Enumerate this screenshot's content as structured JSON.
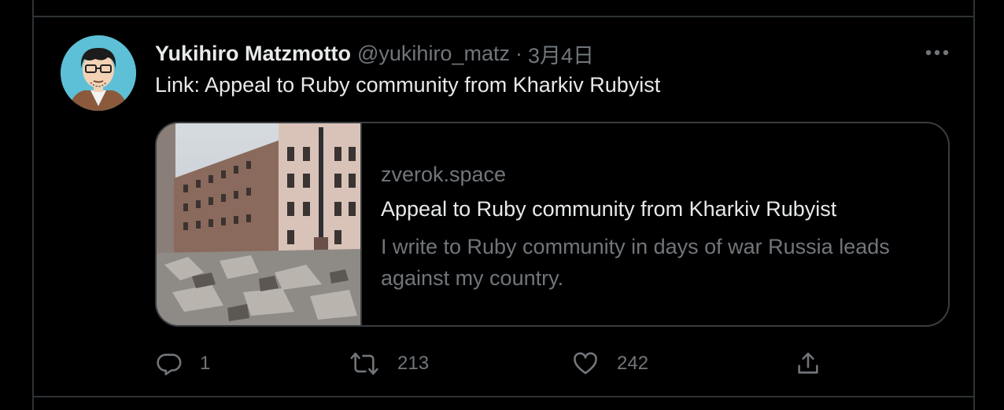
{
  "tweet": {
    "author_name": "Yukihiro Matzmotto",
    "author_handle": "@yukihiro_matz",
    "separator": "·",
    "timestamp": "3月4日",
    "text": "Link: Appeal to Ruby community from Kharkiv Rubyist"
  },
  "card": {
    "domain": "zverok.space",
    "title": "Appeal to Ruby community from Kharkiv Rubyist",
    "description": "I write to Ruby community in days of war Russia leads against my country."
  },
  "actions": {
    "reply_count": "1",
    "retweet_count": "213",
    "like_count": "242"
  },
  "icons": {
    "more": "more-icon",
    "reply": "reply-icon",
    "retweet": "retweet-icon",
    "like": "heart-icon",
    "share": "share-icon"
  },
  "colors": {
    "background": "#000000",
    "primary_text": "#e7e9ea",
    "secondary_text": "#71767b",
    "border": "#2f3336"
  }
}
